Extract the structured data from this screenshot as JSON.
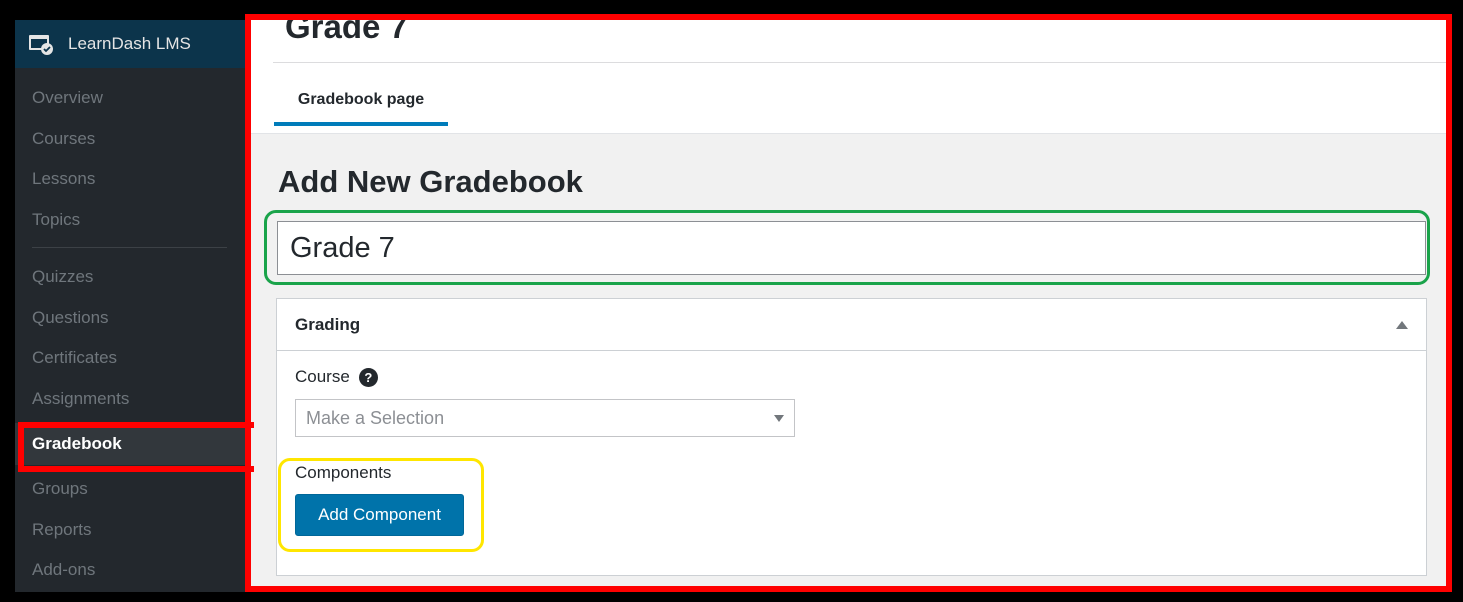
{
  "brand": {
    "name": "LearnDash LMS",
    "icon": "learndash-laptop-icon"
  },
  "sidebar": {
    "items": [
      {
        "label": "Overview"
      },
      {
        "label": "Courses"
      },
      {
        "label": "Lessons"
      },
      {
        "label": "Topics"
      },
      {
        "label": "Quizzes"
      },
      {
        "label": "Questions"
      },
      {
        "label": "Certificates"
      },
      {
        "label": "Assignments"
      },
      {
        "label": "Gradebook",
        "active": true
      },
      {
        "label": "Groups"
      },
      {
        "label": "Reports"
      },
      {
        "label": "Add-ons"
      }
    ]
  },
  "header": {
    "title": "Grade 7",
    "tabs": [
      {
        "label": "Gradebook page",
        "active": true
      }
    ]
  },
  "main": {
    "heading": "Add New Gradebook",
    "title_input_value": "Grade 7",
    "panel": {
      "title": "Grading",
      "course_label": "Course",
      "course_help_icon": "question-circle-icon",
      "course_select_placeholder": "Make a Selection",
      "components_label": "Components",
      "add_component_label": "Add Component"
    }
  },
  "colors": {
    "sidebar_bg": "#23282d",
    "brand_bg": "#0c344b",
    "accent": "#007cba",
    "button": "#0073aa",
    "annotation_red": "#ff0000",
    "annotation_green": "#1aa34a",
    "annotation_yellow": "#ffe600"
  }
}
